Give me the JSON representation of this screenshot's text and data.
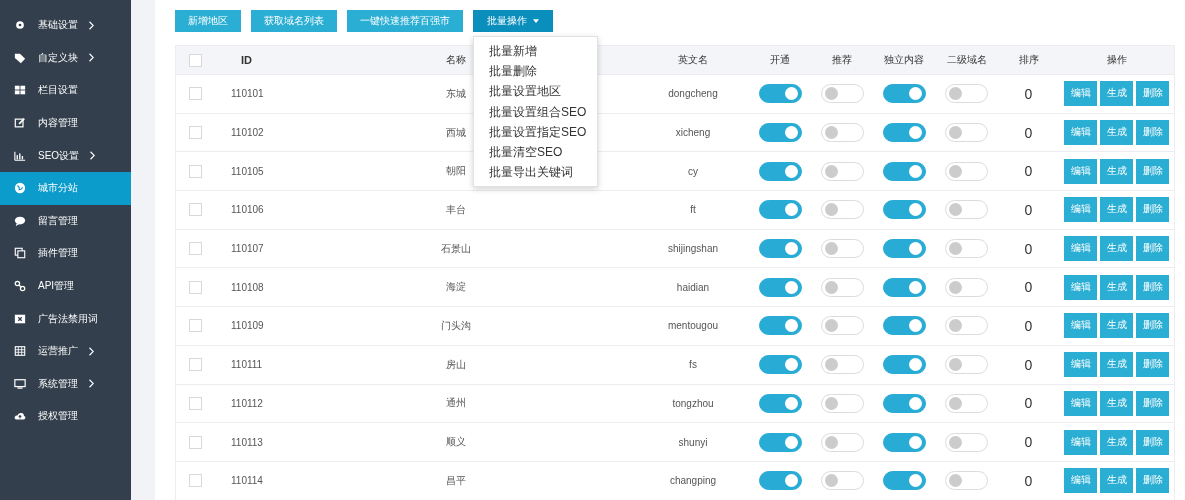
{
  "sidebar": {
    "items": [
      {
        "label": "基础设置",
        "has_submenu": true,
        "selected": false
      },
      {
        "label": "自定义块",
        "has_submenu": true,
        "selected": false
      },
      {
        "label": "栏目设置",
        "has_submenu": false,
        "selected": false
      },
      {
        "label": "内容管理",
        "has_submenu": false,
        "selected": false
      },
      {
        "label": "SEO设置",
        "has_submenu": true,
        "selected": false
      },
      {
        "label": "城市分站",
        "has_submenu": false,
        "selected": true
      },
      {
        "label": "留言管理",
        "has_submenu": false,
        "selected": false
      },
      {
        "label": "插件管理",
        "has_submenu": false,
        "selected": false
      },
      {
        "label": "API管理",
        "has_submenu": false,
        "selected": false
      },
      {
        "label": "广告法禁用词",
        "has_submenu": false,
        "selected": false
      },
      {
        "label": "运营推广",
        "has_submenu": true,
        "selected": false
      },
      {
        "label": "系统管理",
        "has_submenu": true,
        "selected": false
      },
      {
        "label": "授权管理",
        "has_submenu": false,
        "selected": false
      }
    ]
  },
  "toolbar": {
    "buttons": [
      {
        "label": "新增地区",
        "kind": "plain"
      },
      {
        "label": "获取域名列表",
        "kind": "plain"
      },
      {
        "label": "一键快速推荐百强市",
        "kind": "plain"
      },
      {
        "label": "批量操作",
        "kind": "dropdown",
        "expanded": true
      }
    ],
    "dropdown_items": [
      "批量新增",
      "批量删除",
      "批量设置地区",
      "批量设置组合SEO",
      "批量设置指定SEO",
      "批量清空SEO",
      "批量导出关键词"
    ]
  },
  "table": {
    "columns": [
      "ID",
      "名称",
      "英文名",
      "开通",
      "推荐",
      "独立内容",
      "二级域名",
      "排序",
      "操作"
    ],
    "select_all_checked": false,
    "rows": [
      {
        "checked": false,
        "id": "110101",
        "name": "东城",
        "english": "dongcheng",
        "open": true,
        "recommend": false,
        "independent": true,
        "subdomain": false,
        "order": "0",
        "actions": [
          "编辑",
          "生成",
          "删除"
        ]
      },
      {
        "checked": false,
        "id": "110102",
        "name": "西城",
        "english": "xicheng",
        "open": true,
        "recommend": false,
        "independent": true,
        "subdomain": false,
        "order": "0",
        "actions": [
          "编辑",
          "生成",
          "删除"
        ]
      },
      {
        "checked": false,
        "id": "110105",
        "name": "朝阳",
        "english": "cy",
        "open": true,
        "recommend": false,
        "independent": true,
        "subdomain": false,
        "order": "0",
        "actions": [
          "编辑",
          "生成",
          "删除"
        ]
      },
      {
        "checked": false,
        "id": "110106",
        "name": "丰台",
        "english": "ft",
        "open": true,
        "recommend": false,
        "independent": true,
        "subdomain": false,
        "order": "0",
        "actions": [
          "编辑",
          "生成",
          "删除"
        ]
      },
      {
        "checked": false,
        "id": "110107",
        "name": "石景山",
        "english": "shijingshan",
        "open": true,
        "recommend": false,
        "independent": true,
        "subdomain": false,
        "order": "0",
        "actions": [
          "编辑",
          "生成",
          "删除"
        ]
      },
      {
        "checked": false,
        "id": "110108",
        "name": "海淀",
        "english": "haidian",
        "open": true,
        "recommend": false,
        "independent": true,
        "subdomain": false,
        "order": "0",
        "actions": [
          "编辑",
          "生成",
          "删除"
        ]
      },
      {
        "checked": false,
        "id": "110109",
        "name": "门头沟",
        "english": "mentougou",
        "open": true,
        "recommend": false,
        "independent": true,
        "subdomain": false,
        "order": "0",
        "actions": [
          "编辑",
          "生成",
          "删除"
        ]
      },
      {
        "checked": false,
        "id": "110111",
        "name": "房山",
        "english": "fs",
        "open": true,
        "recommend": false,
        "independent": true,
        "subdomain": false,
        "order": "0",
        "actions": [
          "编辑",
          "生成",
          "删除"
        ]
      },
      {
        "checked": false,
        "id": "110112",
        "name": "通州",
        "english": "tongzhou",
        "open": true,
        "recommend": false,
        "independent": true,
        "subdomain": false,
        "order": "0",
        "actions": [
          "编辑",
          "生成",
          "删除"
        ]
      },
      {
        "checked": false,
        "id": "110113",
        "name": "顺义",
        "english": "shunyi",
        "open": true,
        "recommend": false,
        "independent": true,
        "subdomain": false,
        "order": "0",
        "actions": [
          "编辑",
          "生成",
          "删除"
        ]
      },
      {
        "checked": false,
        "id": "110114",
        "name": "昌平",
        "english": "changping",
        "open": true,
        "recommend": false,
        "independent": true,
        "subdomain": false,
        "order": "0",
        "actions": [
          "编辑",
          "生成",
          "删除"
        ]
      }
    ]
  }
}
